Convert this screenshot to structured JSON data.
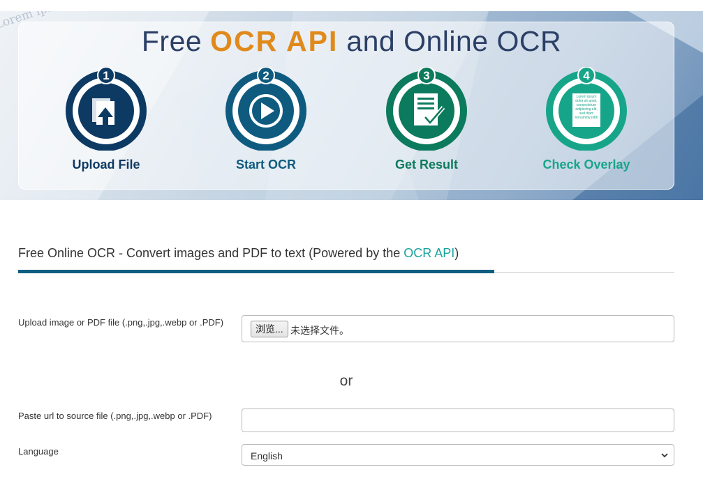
{
  "hero": {
    "title_before": "Free ",
    "title_accent": "OCR API",
    "title_after": " and Online OCR",
    "background_text": "Lorem ipsum dolor sit amet, consectetuer adipiscing elit, sed diam nonummy nibh euismod tincidunt ut laoreet dolore magna aliquam erat volutpat. Ut wisi enim ad minim veniam, quis nostrud exerci tation ullamcorper suscipit lobortis nisl ut aliquip ex ea commodo consequat. Duis autem vel eum iriure dolor in hendrerit in vulputate velit esse molestie consequat, vel illum dolore eu feugiat nulla facilisis at vero eros et accumsan et iusto odio dignissim qui blandit praesent luptatum zzril delenit augue duis dolore te feugait nulla facilisi. Nam liber tempor cum soluta nobis eleifend option congue nihil imperdiet doming id quod mazim placerat facer possim assum.",
    "steps": [
      {
        "number": "1",
        "label": "Upload File",
        "color": "#0d3a63",
        "icon": "upload-file-icon"
      },
      {
        "number": "2",
        "label": "Start OCR",
        "color": "#0f5b80",
        "icon": "play-icon"
      },
      {
        "number": "3",
        "label": "Get Result",
        "color": "#0c7a5c",
        "icon": "document-check-icon"
      },
      {
        "number": "4",
        "label": "Check Overlay",
        "color": "#17a58a",
        "icon": "text-overlay-icon",
        "overlay_text": "Lorem ipsum dolor sit amet, consectetuer adipiscing elit, sed diam nonummy nibh"
      }
    ]
  },
  "main": {
    "title": "Free Online OCR - Convert images and PDF to text (Powered by the ",
    "title_link": "OCR API",
    "title_end": ")"
  },
  "form": {
    "upload_label": "Upload image or PDF file (.png,.jpg,.webp or .PDF)",
    "browse_button": "浏览...",
    "file_status": "未选择文件。",
    "or_text": "or",
    "url_label": "Paste url to source file (.png,.jpg,.webp or .PDF)",
    "url_value": "",
    "language_label": "Language",
    "language_value": "English"
  },
  "colors": {
    "accent_orange": "#e08a1c",
    "title_blue": "#2b3f66",
    "link_teal": "#1aa39b",
    "tab_rule": "#0f5e82"
  }
}
